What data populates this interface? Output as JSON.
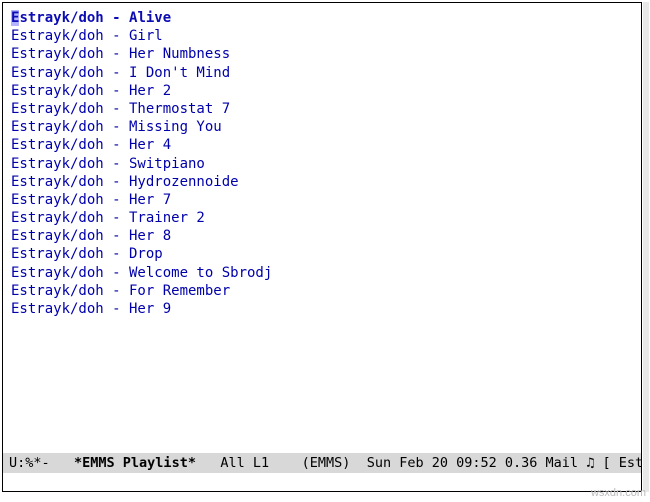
{
  "playlist": {
    "items": [
      {
        "artist": "Estrayk/doh",
        "title": "Alive",
        "current": true
      },
      {
        "artist": "Estrayk/doh",
        "title": "Girl",
        "current": false
      },
      {
        "artist": "Estrayk/doh",
        "title": "Her Numbness",
        "current": false
      },
      {
        "artist": "Estrayk/doh",
        "title": "I Don't Mind",
        "current": false
      },
      {
        "artist": "Estrayk/doh",
        "title": "Her 2",
        "current": false
      },
      {
        "artist": "Estrayk/doh",
        "title": "Thermostat 7",
        "current": false
      },
      {
        "artist": "Estrayk/doh",
        "title": "Missing You",
        "current": false
      },
      {
        "artist": "Estrayk/doh",
        "title": "Her 4",
        "current": false
      },
      {
        "artist": "Estrayk/doh",
        "title": "Switpiano",
        "current": false
      },
      {
        "artist": "Estrayk/doh",
        "title": "Hydrozennoide",
        "current": false
      },
      {
        "artist": "Estrayk/doh",
        "title": "Her 7",
        "current": false
      },
      {
        "artist": "Estrayk/doh",
        "title": "Trainer 2",
        "current": false
      },
      {
        "artist": "Estrayk/doh",
        "title": "Her 8",
        "current": false
      },
      {
        "artist": "Estrayk/doh",
        "title": "Drop",
        "current": false
      },
      {
        "artist": "Estrayk/doh",
        "title": "Welcome to Sbrodj",
        "current": false
      },
      {
        "artist": "Estrayk/doh",
        "title": "For Remember",
        "current": false
      },
      {
        "artist": "Estrayk/doh",
        "title": "Her 9",
        "current": false
      }
    ]
  },
  "modeline": {
    "left": "U:%*-",
    "buffer_name": "*EMMS Playlist*",
    "position": "All L1",
    "mode": "(EMMS)",
    "datetime": "Sun Feb 20 09:52",
    "load": "0.36",
    "mail_label": "Mail",
    "music_icon": "♫",
    "tail": "[ Est"
  },
  "watermark": "wsxdn.com"
}
